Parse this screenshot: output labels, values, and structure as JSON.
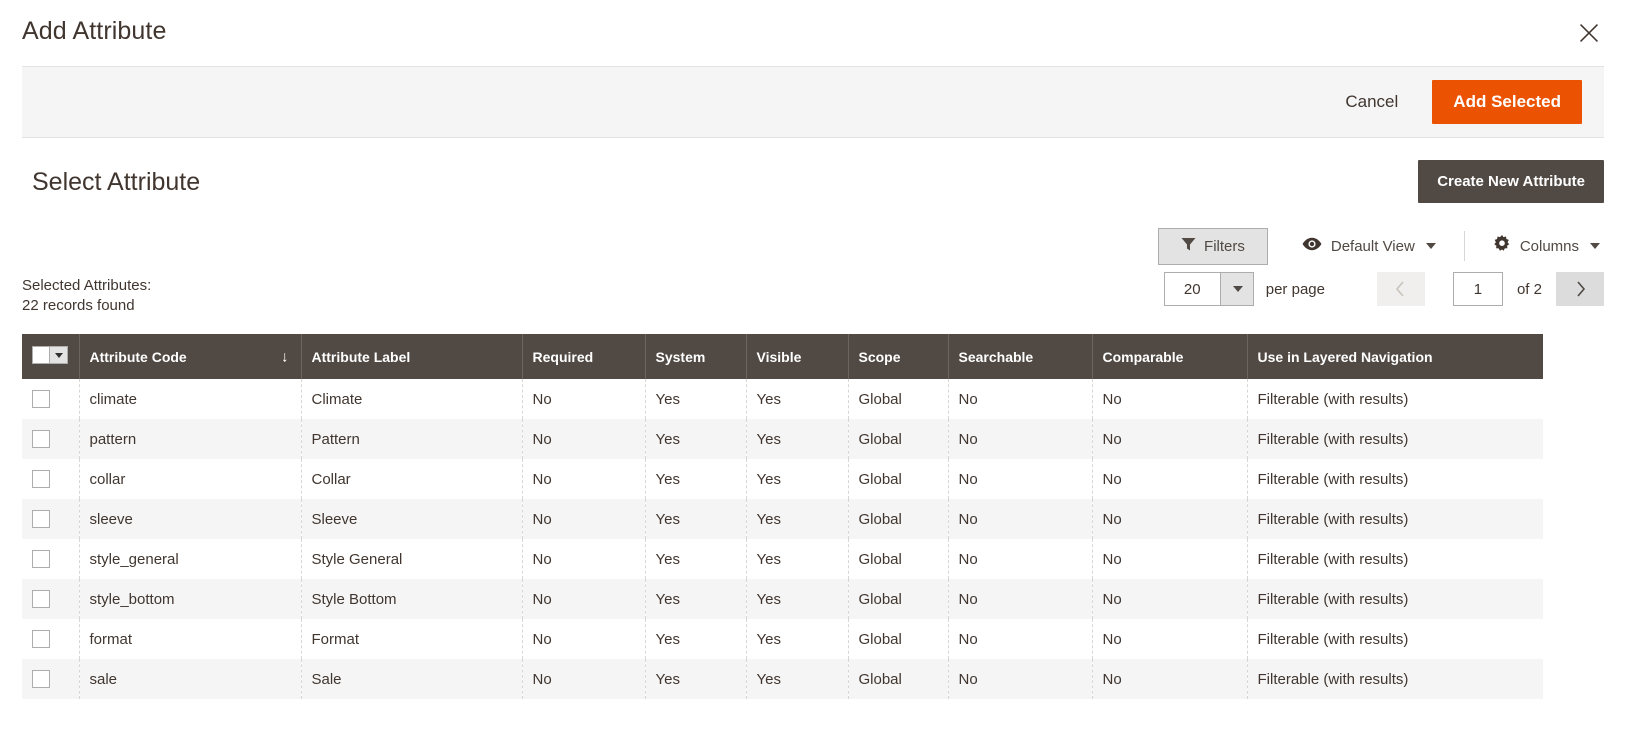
{
  "modal": {
    "title": "Add Attribute",
    "close_icon": "close-icon"
  },
  "action_bar": {
    "cancel_label": "Cancel",
    "add_selected_label": "Add Selected",
    "primary_color": "#eb5202"
  },
  "page": {
    "title": "Select Attribute",
    "create_new_label": "Create New Attribute",
    "dark_button_color": "#514943"
  },
  "toolbar": {
    "filters_label": "Filters",
    "filters_icon": "funnel-icon",
    "view_label": "Default View",
    "view_icon": "eye-icon",
    "columns_label": "Columns",
    "columns_icon": "gear-icon"
  },
  "records": {
    "selected_label": "Selected Attributes:",
    "found_label": "22 records found"
  },
  "pagination": {
    "per_page_value": "20",
    "per_page_label": "per page",
    "current_page": "1",
    "of_label": "of 2",
    "prev_icon": "chevron-left-icon",
    "next_icon": "chevron-right-icon"
  },
  "grid": {
    "header_bg": "#514943",
    "sort_indicator": "↓",
    "sorted_column": "Attribute Code",
    "columns": [
      "Attribute Code",
      "Attribute Label",
      "Required",
      "System",
      "Visible",
      "Scope",
      "Searchable",
      "Comparable",
      "Use in Layered Navigation"
    ],
    "rows": [
      {
        "code": "climate",
        "label": "Climate",
        "required": "No",
        "system": "Yes",
        "visible": "Yes",
        "scope": "Global",
        "searchable": "No",
        "comparable": "No",
        "layered": "Filterable (with results)"
      },
      {
        "code": "pattern",
        "label": "Pattern",
        "required": "No",
        "system": "Yes",
        "visible": "Yes",
        "scope": "Global",
        "searchable": "No",
        "comparable": "No",
        "layered": "Filterable (with results)"
      },
      {
        "code": "collar",
        "label": "Collar",
        "required": "No",
        "system": "Yes",
        "visible": "Yes",
        "scope": "Global",
        "searchable": "No",
        "comparable": "No",
        "layered": "Filterable (with results)"
      },
      {
        "code": "sleeve",
        "label": "Sleeve",
        "required": "No",
        "system": "Yes",
        "visible": "Yes",
        "scope": "Global",
        "searchable": "No",
        "comparable": "No",
        "layered": "Filterable (with results)"
      },
      {
        "code": "style_general",
        "label": "Style General",
        "required": "No",
        "system": "Yes",
        "visible": "Yes",
        "scope": "Global",
        "searchable": "No",
        "comparable": "No",
        "layered": "Filterable (with results)"
      },
      {
        "code": "style_bottom",
        "label": "Style Bottom",
        "required": "No",
        "system": "Yes",
        "visible": "Yes",
        "scope": "Global",
        "searchable": "No",
        "comparable": "No",
        "layered": "Filterable (with results)"
      },
      {
        "code": "format",
        "label": "Format",
        "required": "No",
        "system": "Yes",
        "visible": "Yes",
        "scope": "Global",
        "searchable": "No",
        "comparable": "No",
        "layered": "Filterable (with results)"
      },
      {
        "code": "sale",
        "label": "Sale",
        "required": "No",
        "system": "Yes",
        "visible": "Yes",
        "scope": "Global",
        "searchable": "No",
        "comparable": "No",
        "layered": "Filterable (with results)"
      }
    ]
  }
}
